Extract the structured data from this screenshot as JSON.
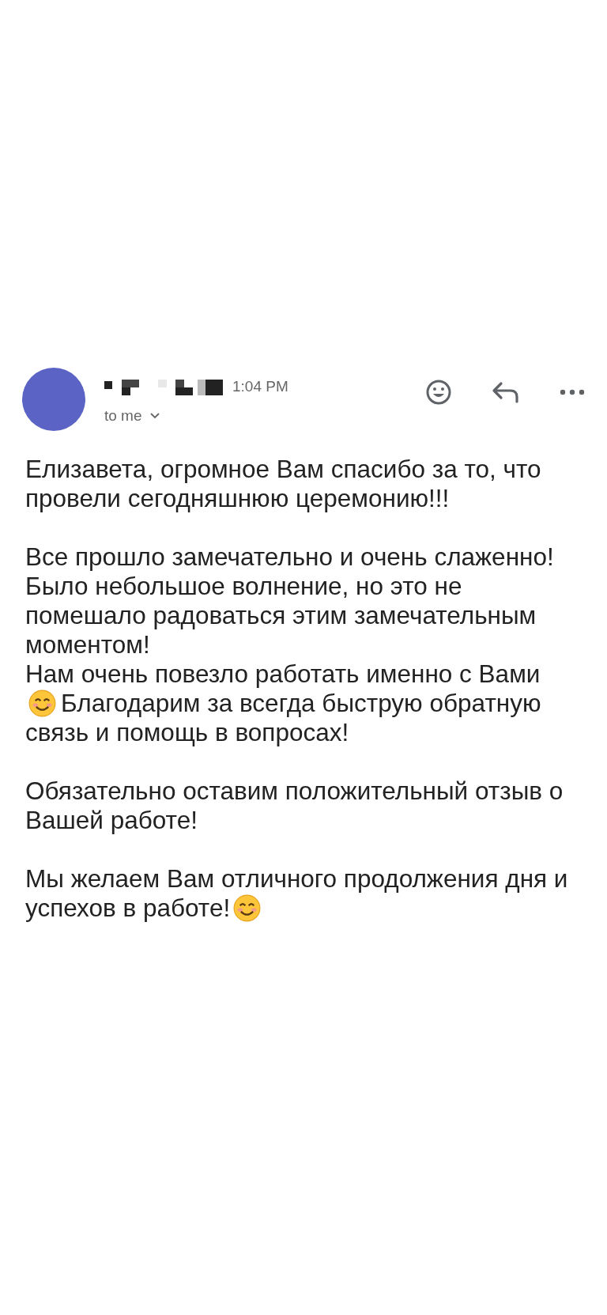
{
  "message": {
    "sender": {
      "kind": "redacted"
    },
    "time": "1:04 PM",
    "recipient": "to me",
    "actions": [
      {
        "kind": "emoji"
      },
      {
        "kind": "reply"
      },
      {
        "kind": "more"
      }
    ],
    "paragraphs": [
      {
        "lines": [
          [
            {
              "kind": "text",
              "text": "Елизавета, огромное Вам спасибо за то, что"
            }
          ],
          [
            {
              "kind": "text",
              "text": "провели сегодняшнюю церемонию!!!"
            }
          ]
        ]
      },
      {
        "lines": [
          [
            {
              "kind": "text",
              "text": "Все прошло замечательно и очень слаженно!"
            }
          ],
          [
            {
              "kind": "text",
              "text": "Было небольшое волнение, но это не"
            }
          ],
          [
            {
              "kind": "text",
              "text": "помешало радоваться этим замечательным"
            }
          ],
          [
            {
              "kind": "text",
              "text": "моментом!"
            }
          ],
          [
            {
              "kind": "text",
              "text": "Нам очень повезло работать именно с Вами"
            }
          ],
          [
            {
              "kind": "emoji"
            },
            {
              "kind": "text",
              "text": "Благодарим за всегда быструю обратную"
            }
          ],
          [
            {
              "kind": "text",
              "text": "связь и помощь в вопросах!"
            }
          ]
        ]
      },
      {
        "lines": [
          [
            {
              "kind": "text",
              "text": "Обязательно оставим положительный отзыв о"
            }
          ],
          [
            {
              "kind": "text",
              "text": "Вашей работе!"
            }
          ]
        ]
      },
      {
        "lines": [
          [
            {
              "kind": "text",
              "text": "Мы желаем Вам отличного продолжения дня и"
            }
          ],
          [
            {
              "kind": "text",
              "text": "успехов в работе!"
            },
            {
              "kind": "emoji"
            }
          ]
        ]
      }
    ]
  }
}
